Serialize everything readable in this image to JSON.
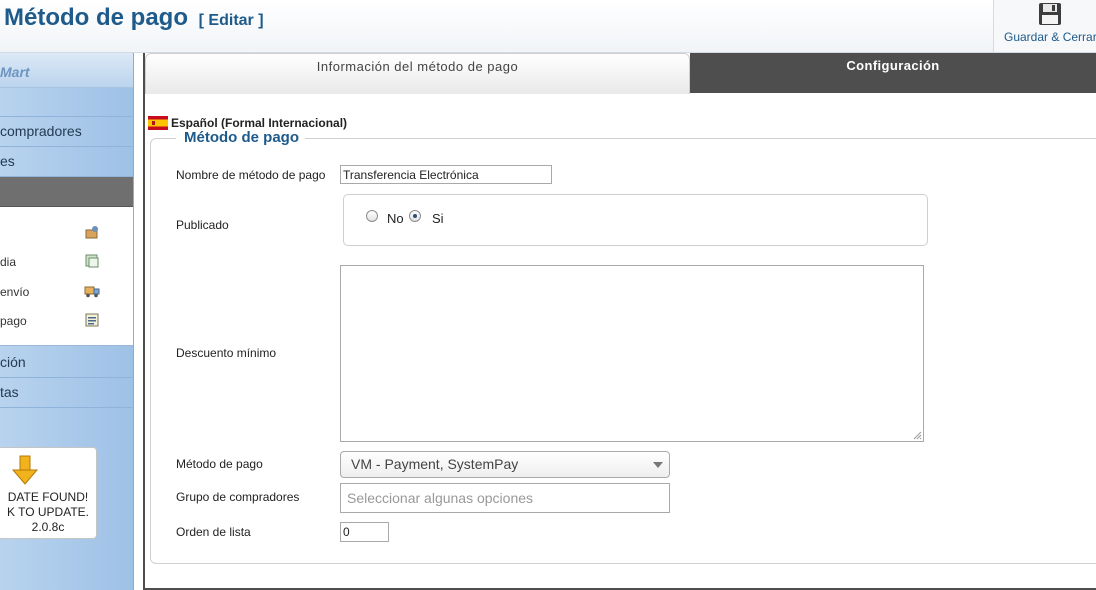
{
  "header": {
    "title": "Método de pago",
    "edit_label": "[ Editar ]",
    "save_close_label": "Guardar & Cerrar"
  },
  "sidebar": {
    "logo_text": "Mart",
    "rows": [
      "",
      " compradores",
      "es"
    ],
    "active_row": "",
    "submenu": [
      {
        "label": "",
        "icon": "product-icon"
      },
      {
        "label": "dia",
        "icon": "media-icon"
      },
      {
        "label": "envío",
        "icon": "shipping-truck-icon"
      },
      {
        "label": "pago",
        "icon": "payment-list-icon"
      }
    ],
    "rows_after": [
      "ción",
      "tas"
    ],
    "update": {
      "line1": "DATE FOUND!",
      "line2": "K TO UPDATE.",
      "version": "2.0.8c"
    }
  },
  "tabs": {
    "info": "Información del método de pago",
    "config": "Configuración"
  },
  "language": {
    "label": "Español (Formal Internacional)",
    "flag": "spain-flag-icon"
  },
  "form": {
    "legend": "Método de pago",
    "name_label": "Nombre de método de pago",
    "name_value": "Transferencia Electrónica",
    "published_label": "Publicado",
    "published_options": [
      "No",
      "Si"
    ],
    "published_selected": "Si",
    "min_discount_label": "Descuento mínimo",
    "min_discount_value": "",
    "payment_method_label": "Método de pago",
    "payment_method_value": "VM - Payment, SystemPay",
    "shopper_group_label": "Grupo de compradores",
    "shopper_group_placeholder": "Seleccionar algunas opciones",
    "order_label": "Orden de lista",
    "order_value": "0"
  },
  "colors": {
    "title_blue": "#1e5a8a",
    "sidebar_blue": "#a9c9ea",
    "tab_dark": "#4e4e4e"
  }
}
